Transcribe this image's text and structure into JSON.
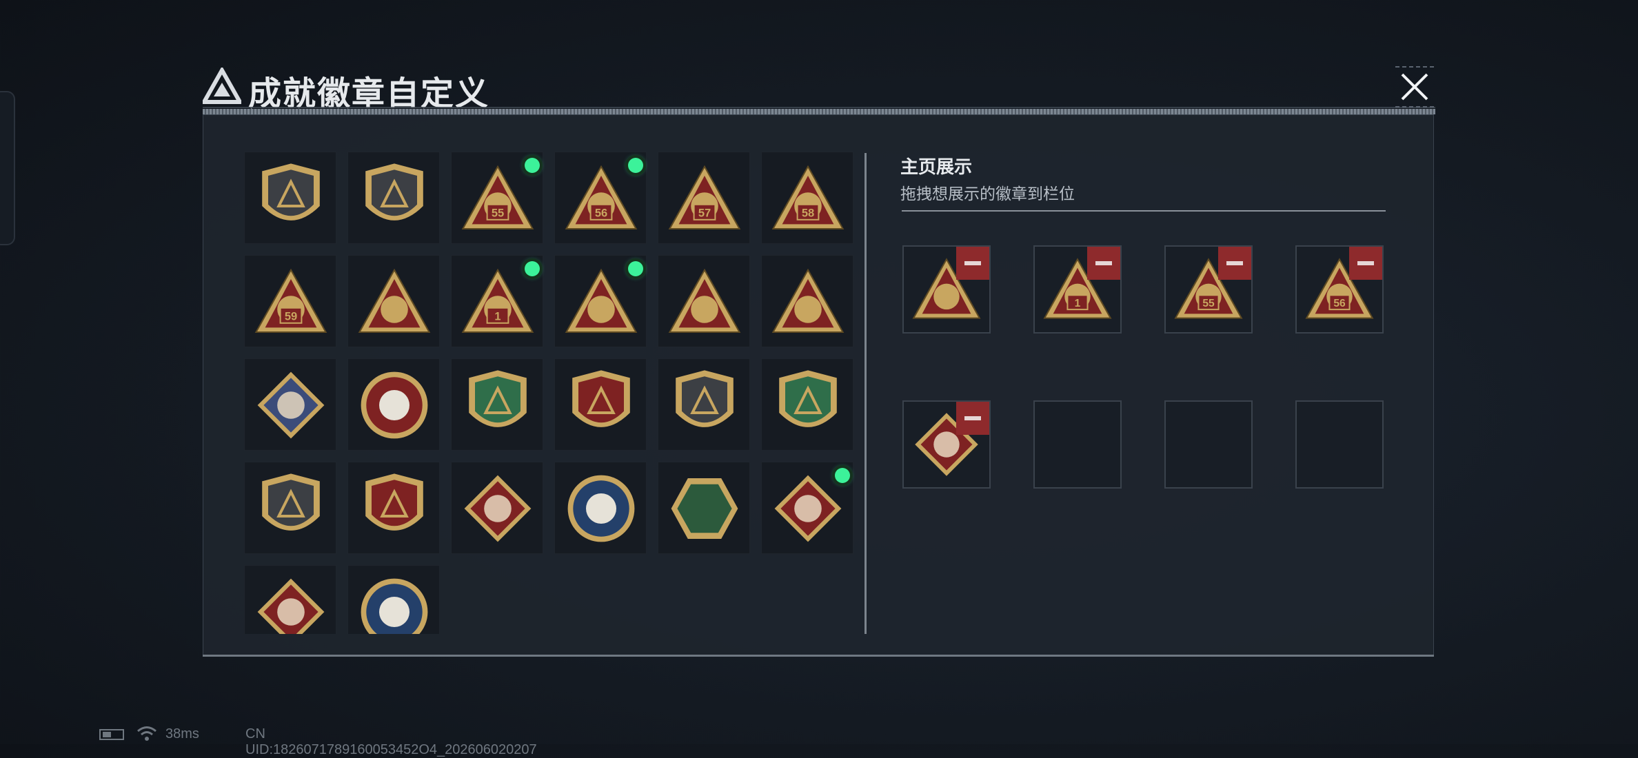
{
  "window": {
    "title": "成就徽章自定义"
  },
  "grid": {
    "badges": [
      {
        "icon": "shield-triangle-logo-badge-icon",
        "selected": false
      },
      {
        "icon": "helicopter-shield-badge-icon",
        "selected": false
      },
      {
        "icon": "season-55-triangle-badge-icon",
        "label": "55",
        "selected": true
      },
      {
        "icon": "season-56-triangle-badge-icon",
        "label": "56",
        "selected": true
      },
      {
        "icon": "season-57-triangle-badge-icon",
        "label": "57",
        "selected": false
      },
      {
        "icon": "season-58-triangle-badge-icon",
        "label": "58",
        "selected": false
      },
      {
        "icon": "season-59-triangle-badge-icon",
        "label": "59",
        "selected": false
      },
      {
        "icon": "hand-triangle-badge-icon",
        "selected": false
      },
      {
        "icon": "number-one-triangle-badge-icon",
        "label": "1",
        "selected": true
      },
      {
        "icon": "sitting-figure-triangle-badge-icon",
        "selected": true
      },
      {
        "icon": "lotus-triangle-badge-icon",
        "selected": false
      },
      {
        "icon": "soldiers-triangle-badge-icon",
        "selected": false
      },
      {
        "icon": "rose-diamond-badge-icon",
        "selected": false
      },
      {
        "icon": "star-compass-badge-icon",
        "selected": false
      },
      {
        "icon": "green-wings-badge-icon",
        "selected": false
      },
      {
        "icon": "stars-ribbon-badge-icon",
        "selected": false
      },
      {
        "icon": "dice-shield-badge-icon",
        "selected": false
      },
      {
        "icon": "green-rifle-laurel-badge-icon",
        "selected": false
      },
      {
        "icon": "pistol-shield-badge-icon",
        "selected": false
      },
      {
        "icon": "crosshair-wings-badge-icon",
        "selected": false
      },
      {
        "icon": "wolf-diamond-badge-icon",
        "selected": false
      },
      {
        "icon": "eagle-circle-badge-icon",
        "selected": false
      },
      {
        "icon": "hornet-hexagon-badge-icon",
        "selected": false
      },
      {
        "icon": "dragon-diamond-badge-icon",
        "selected": true
      },
      {
        "icon": "runner-diamond-badge-icon",
        "selected": false
      },
      {
        "icon": "lynx-circle-badge-icon",
        "selected": false
      }
    ]
  },
  "home_display": {
    "title": "主页展示",
    "subtitle": "拖拽想展示的徽章到栏位",
    "slots": [
      {
        "icon": "sitting-figure-triangle-badge-icon",
        "filled": true
      },
      {
        "icon": "number-one-triangle-badge-icon",
        "label": "1",
        "filled": true
      },
      {
        "icon": "season-55-triangle-badge-icon",
        "label": "55",
        "filled": true
      },
      {
        "icon": "season-56-triangle-badge-icon",
        "label": "56",
        "filled": true
      },
      {
        "icon": "dragon-diamond-badge-icon",
        "filled": true
      },
      {
        "filled": false
      },
      {
        "filled": false
      },
      {
        "filled": false
      }
    ]
  },
  "status_bar": {
    "ping": "38ms",
    "uid": "CN UID:1826071789160053452O4_202606020207"
  },
  "colors": {
    "accent_green": "#3cf29a",
    "remove_red": "#8e2a2c",
    "badge_gold": "#c8a660",
    "badge_red": "#7e2222",
    "panel_bg": "#1e252e"
  }
}
